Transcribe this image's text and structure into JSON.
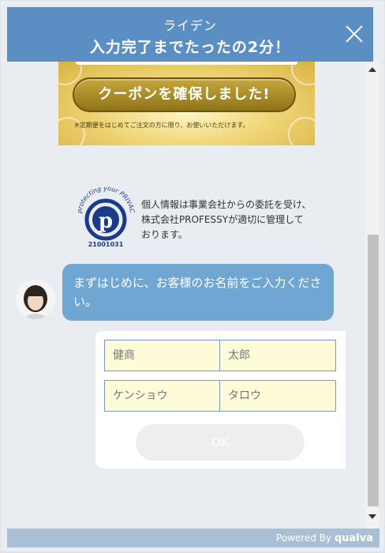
{
  "header": {
    "subtitle": "ライデン",
    "title": "入力完了までたったの2分！"
  },
  "coupon": {
    "button_label": "クーポンを確保しました!",
    "note": "※定期便をはじめてご注文の方に限り、お使いいただけます。"
  },
  "privacy": {
    "mark_text_top": "protecting your PRIVACY",
    "mark_number": "21001031",
    "text": "個人情報は事業会社からの委託を受け、株式会社PROFESSYが適切に管理しております。"
  },
  "chat": {
    "message": "まずはじめに、お客様のお名前をご入力ください。"
  },
  "form": {
    "last_name_placeholder": "健商",
    "first_name_placeholder": "太郎",
    "last_kana_placeholder": "ケンショウ",
    "first_kana_placeholder": "タロウ",
    "ok_label": "OK"
  },
  "footer": {
    "powered_by": "Powered By",
    "brand": "qualva"
  },
  "colors": {
    "header": "#5b8fc3",
    "bubble": "#70a6d2",
    "input_bg": "#fefbd8",
    "input_border": "#7d96c9",
    "footer": "#a9bfd6"
  }
}
